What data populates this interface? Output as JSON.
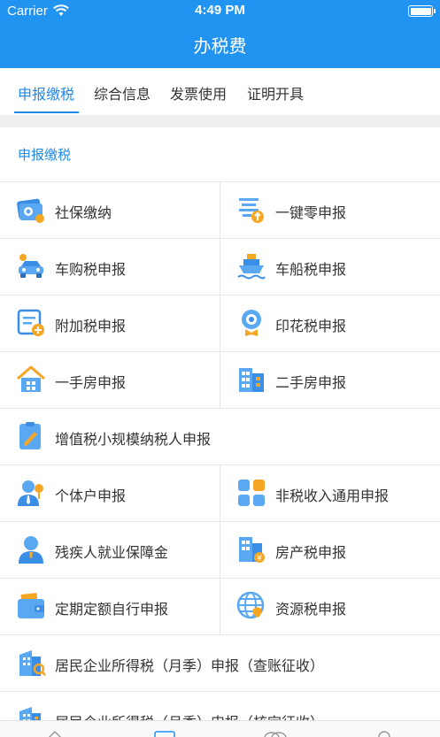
{
  "status_bar": {
    "carrier": "Carrier",
    "time": "4:49 PM"
  },
  "header": {
    "title": "办税费"
  },
  "tabs": [
    {
      "label": "申报缴税",
      "active": true
    },
    {
      "label": "综合信息",
      "active": false
    },
    {
      "label": "发票使用",
      "active": false
    },
    {
      "label": "证明开具",
      "active": false
    }
  ],
  "section": {
    "title": "申报缴税"
  },
  "items": [
    {
      "label": "社保缴纳",
      "icon": "social-security-card-icon"
    },
    {
      "label": "一键零申报",
      "icon": "zero-declare-icon"
    },
    {
      "label": "车购税申报",
      "icon": "car-icon"
    },
    {
      "label": "车船税申报",
      "icon": "ship-icon"
    },
    {
      "label": "附加税申报",
      "icon": "add-form-icon"
    },
    {
      "label": "印花税申报",
      "icon": "stamp-icon"
    },
    {
      "label": "一手房申报",
      "icon": "house-icon"
    },
    {
      "label": "二手房申报",
      "icon": "building-icon"
    },
    {
      "label": "增值税小规模纳税人申报",
      "icon": "clipboard-pen-icon"
    },
    {
      "label": "个体户申报",
      "icon": "person-tie-icon"
    },
    {
      "label": "非税收入通用申报",
      "icon": "grid-apps-icon"
    },
    {
      "label": "残疾人就业保障金",
      "icon": "person-icon"
    },
    {
      "label": "房产税申报",
      "icon": "building-coin-icon"
    },
    {
      "label": "定期定额自行申报",
      "icon": "wallet-icon"
    },
    {
      "label": "资源税申报",
      "icon": "globe-icon"
    },
    {
      "label": "居民企业所得税（月季）申报（查账征收）",
      "icon": "office-building-search-icon"
    },
    {
      "label": "居民企业所得税（月季）申报（核定征收）",
      "icon": "office-building-icon"
    }
  ],
  "colors": {
    "brand": "#2193f0",
    "accent": "#1d8ae8",
    "orange": "#f5a623"
  },
  "bottom_nav_icons": [
    "home-icon",
    "tax-office-icon",
    "chat-icon",
    "profile-icon"
  ]
}
